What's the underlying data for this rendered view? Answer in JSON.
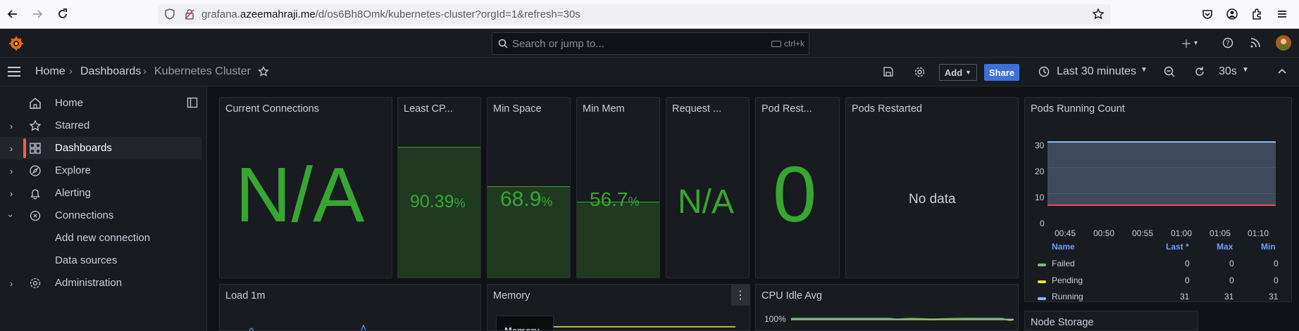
{
  "browser": {
    "url_prefix": "grafana.",
    "url_domain": "azeemahraji.me",
    "url_path": "/d/os6Bh8Omk/kubernetes-cluster?orgId=1&refresh=30s"
  },
  "topbar": {
    "search_placeholder": "Search or jump to...",
    "shortcut": "ctrl+k"
  },
  "breadcrumb": {
    "home": "Home",
    "dashboards": "Dashboards",
    "current": "Kubernetes Cluster"
  },
  "toolbar": {
    "add_label": "Add",
    "share_label": "Share",
    "time_range": "Last 30 minutes",
    "refresh_interval": "30s"
  },
  "sidebar": {
    "items": [
      {
        "label": "Home"
      },
      {
        "label": "Starred"
      },
      {
        "label": "Dashboards"
      },
      {
        "label": "Explore"
      },
      {
        "label": "Alerting"
      },
      {
        "label": "Connections"
      },
      {
        "label": "Add new connection"
      },
      {
        "label": "Data sources"
      },
      {
        "label": "Administration"
      }
    ]
  },
  "panels": {
    "current_connections": {
      "title": "Current Connections",
      "value": "N/A"
    },
    "least_cpu": {
      "title": "Least CP...",
      "value": "90.39",
      "unit": "%",
      "fill_fraction": 0.9039
    },
    "min_space": {
      "title": "Min Space",
      "value": "68.9",
      "unit": "%",
      "fill_fraction": 0.689
    },
    "min_mem": {
      "title": "Min Mem",
      "value": "56.7",
      "unit": "%",
      "fill_fraction": 0.567
    },
    "request": {
      "title": "Request ...",
      "value": "N/A"
    },
    "pod_restarts": {
      "title": "Pod Rest...",
      "value": "0"
    },
    "pods_restarted": {
      "title": "Pods Restarted",
      "value": "No data"
    },
    "pods_running": {
      "title": "Pods Running Count",
      "y_ticks": [
        "30",
        "20",
        "10",
        "0"
      ],
      "x_ticks": [
        "00:45",
        "00:50",
        "00:55",
        "01:00",
        "01:05",
        "01:10"
      ],
      "legend_headers": {
        "name": "Name",
        "last": "Last *",
        "max": "Max",
        "min": "Min"
      },
      "legend": [
        {
          "name": "Failed",
          "last": "0",
          "max": "0",
          "min": "0",
          "color": "#73bf69"
        },
        {
          "name": "Pending",
          "last": "0",
          "max": "0",
          "min": "0",
          "color": "#fade2a"
        },
        {
          "name": "Running",
          "last": "31",
          "max": "31",
          "min": "31",
          "color": "#8ab8ff"
        }
      ]
    },
    "load_1m": {
      "title": "Load 1m"
    },
    "memory": {
      "title": "Memory",
      "tooltip": "Memory"
    },
    "cpu_idle_avg": {
      "title": "CPU Idle Avg",
      "y_tick": "100%"
    },
    "node_storage": {
      "title": "Node Storage"
    }
  },
  "colors": {
    "stat_green": "#37a632",
    "accent_orange": "#f55f3e",
    "share_blue": "#3d71d9"
  }
}
